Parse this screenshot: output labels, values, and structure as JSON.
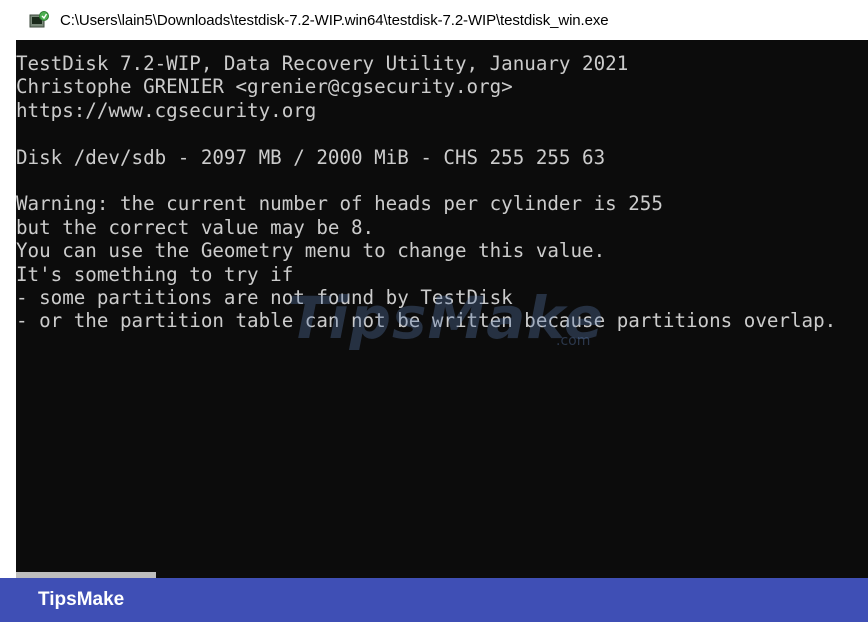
{
  "window": {
    "title": "C:\\Users\\lain5\\Downloads\\testdisk-7.2-WIP.win64\\testdisk-7.2-WIP\\testdisk_win.exe",
    "icon": "console-app-icon"
  },
  "console": {
    "lines": [
      "TestDisk 7.2-WIP, Data Recovery Utility, January 2021",
      "Christophe GRENIER <grenier@cgsecurity.org>",
      "https://www.cgsecurity.org",
      "",
      "Disk /dev/sdb - 2097 MB / 2000 MiB - CHS 255 255 63",
      "",
      "Warning: the current number of heads per cylinder is 255",
      "but the correct value may be 8.",
      "You can use the Geometry menu to change this value.",
      "It's something to try if",
      "- some partitions are not found by TestDisk",
      "- or the partition table can not be written because partitions overlap."
    ]
  },
  "watermark": {
    "text": "TipsMake",
    "suffix": ".com"
  },
  "banner": {
    "text": "TipsMake"
  },
  "colors": {
    "console_bg": "#0c0c0c",
    "console_text": "#cccccc",
    "banner_bg": "#3f4fb5"
  }
}
